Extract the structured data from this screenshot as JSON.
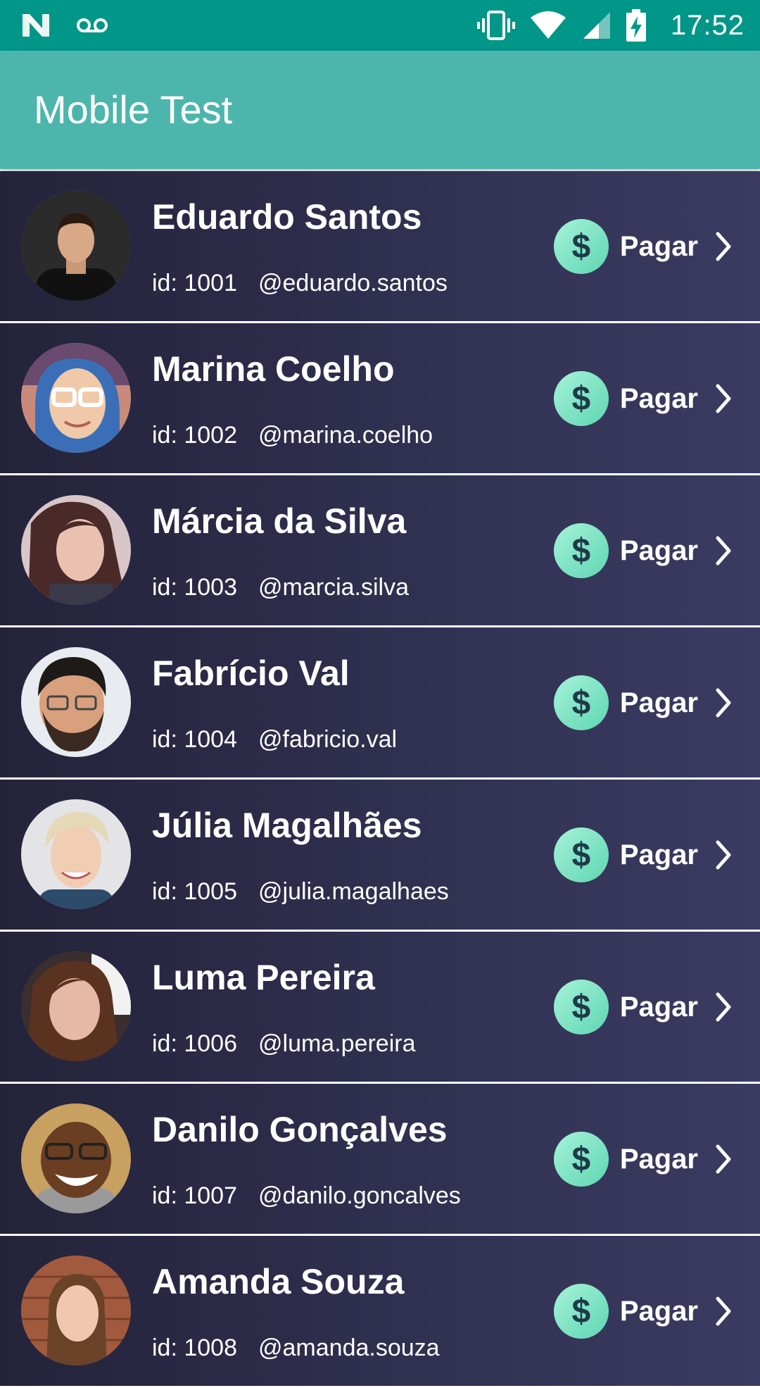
{
  "status_bar": {
    "time": "17:52",
    "icons": [
      "n-logo-icon",
      "voicemail-icon",
      "vibrate-icon",
      "wifi-icon",
      "signal-icon",
      "battery-charging-icon"
    ]
  },
  "app_bar": {
    "title": "Mobile Test",
    "color": "#4db6ac"
  },
  "contacts": [
    {
      "name": "Eduardo Santos",
      "id": "id: 1001",
      "username": "@eduardo.santos",
      "pay_label": "Pagar"
    },
    {
      "name": "Marina Coelho",
      "id": "id: 1002",
      "username": "@marina.coelho",
      "pay_label": "Pagar"
    },
    {
      "name": "Márcia da Silva",
      "id": "id: 1003",
      "username": "@marcia.silva",
      "pay_label": "Pagar"
    },
    {
      "name": "Fabrício Val",
      "id": "id: 1004",
      "username": "@fabricio.val",
      "pay_label": "Pagar"
    },
    {
      "name": "Júlia Magalhães",
      "id": "id: 1005",
      "username": "@julia.magalhaes",
      "pay_label": "Pagar"
    },
    {
      "name": "Luma Pereira",
      "id": "id: 1006",
      "username": "@luma.pereira",
      "pay_label": "Pagar"
    },
    {
      "name": "Danilo Gonçalves",
      "id": "id: 1007",
      "username": "@danilo.goncalves",
      "pay_label": "Pagar"
    },
    {
      "name": "Amanda Souza",
      "id": "id: 1008",
      "username": "@amanda.souza",
      "pay_label": "Pagar"
    }
  ],
  "pay_icon_symbol": "$",
  "colors": {
    "status_bar": "#009688",
    "row_gradient_start": "#23233a",
    "row_gradient_end": "#3b3b62",
    "pay_icon": "#7ee8c4"
  }
}
